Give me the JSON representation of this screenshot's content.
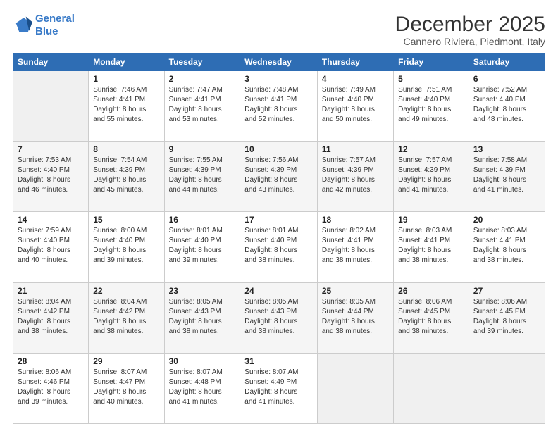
{
  "logo": {
    "line1": "General",
    "line2": "Blue"
  },
  "title": "December 2025",
  "subtitle": "Cannero Riviera, Piedmont, Italy",
  "header_days": [
    "Sunday",
    "Monday",
    "Tuesday",
    "Wednesday",
    "Thursday",
    "Friday",
    "Saturday"
  ],
  "weeks": [
    [
      {
        "day": "",
        "info": ""
      },
      {
        "day": "1",
        "info": "Sunrise: 7:46 AM\nSunset: 4:41 PM\nDaylight: 8 hours\nand 55 minutes."
      },
      {
        "day": "2",
        "info": "Sunrise: 7:47 AM\nSunset: 4:41 PM\nDaylight: 8 hours\nand 53 minutes."
      },
      {
        "day": "3",
        "info": "Sunrise: 7:48 AM\nSunset: 4:41 PM\nDaylight: 8 hours\nand 52 minutes."
      },
      {
        "day": "4",
        "info": "Sunrise: 7:49 AM\nSunset: 4:40 PM\nDaylight: 8 hours\nand 50 minutes."
      },
      {
        "day": "5",
        "info": "Sunrise: 7:51 AM\nSunset: 4:40 PM\nDaylight: 8 hours\nand 49 minutes."
      },
      {
        "day": "6",
        "info": "Sunrise: 7:52 AM\nSunset: 4:40 PM\nDaylight: 8 hours\nand 48 minutes."
      }
    ],
    [
      {
        "day": "7",
        "info": "Sunrise: 7:53 AM\nSunset: 4:40 PM\nDaylight: 8 hours\nand 46 minutes."
      },
      {
        "day": "8",
        "info": "Sunrise: 7:54 AM\nSunset: 4:39 PM\nDaylight: 8 hours\nand 45 minutes."
      },
      {
        "day": "9",
        "info": "Sunrise: 7:55 AM\nSunset: 4:39 PM\nDaylight: 8 hours\nand 44 minutes."
      },
      {
        "day": "10",
        "info": "Sunrise: 7:56 AM\nSunset: 4:39 PM\nDaylight: 8 hours\nand 43 minutes."
      },
      {
        "day": "11",
        "info": "Sunrise: 7:57 AM\nSunset: 4:39 PM\nDaylight: 8 hours\nand 42 minutes."
      },
      {
        "day": "12",
        "info": "Sunrise: 7:57 AM\nSunset: 4:39 PM\nDaylight: 8 hours\nand 41 minutes."
      },
      {
        "day": "13",
        "info": "Sunrise: 7:58 AM\nSunset: 4:39 PM\nDaylight: 8 hours\nand 41 minutes."
      }
    ],
    [
      {
        "day": "14",
        "info": "Sunrise: 7:59 AM\nSunset: 4:40 PM\nDaylight: 8 hours\nand 40 minutes."
      },
      {
        "day": "15",
        "info": "Sunrise: 8:00 AM\nSunset: 4:40 PM\nDaylight: 8 hours\nand 39 minutes."
      },
      {
        "day": "16",
        "info": "Sunrise: 8:01 AM\nSunset: 4:40 PM\nDaylight: 8 hours\nand 39 minutes."
      },
      {
        "day": "17",
        "info": "Sunrise: 8:01 AM\nSunset: 4:40 PM\nDaylight: 8 hours\nand 38 minutes."
      },
      {
        "day": "18",
        "info": "Sunrise: 8:02 AM\nSunset: 4:41 PM\nDaylight: 8 hours\nand 38 minutes."
      },
      {
        "day": "19",
        "info": "Sunrise: 8:03 AM\nSunset: 4:41 PM\nDaylight: 8 hours\nand 38 minutes."
      },
      {
        "day": "20",
        "info": "Sunrise: 8:03 AM\nSunset: 4:41 PM\nDaylight: 8 hours\nand 38 minutes."
      }
    ],
    [
      {
        "day": "21",
        "info": "Sunrise: 8:04 AM\nSunset: 4:42 PM\nDaylight: 8 hours\nand 38 minutes."
      },
      {
        "day": "22",
        "info": "Sunrise: 8:04 AM\nSunset: 4:42 PM\nDaylight: 8 hours\nand 38 minutes."
      },
      {
        "day": "23",
        "info": "Sunrise: 8:05 AM\nSunset: 4:43 PM\nDaylight: 8 hours\nand 38 minutes."
      },
      {
        "day": "24",
        "info": "Sunrise: 8:05 AM\nSunset: 4:43 PM\nDaylight: 8 hours\nand 38 minutes."
      },
      {
        "day": "25",
        "info": "Sunrise: 8:05 AM\nSunset: 4:44 PM\nDaylight: 8 hours\nand 38 minutes."
      },
      {
        "day": "26",
        "info": "Sunrise: 8:06 AM\nSunset: 4:45 PM\nDaylight: 8 hours\nand 38 minutes."
      },
      {
        "day": "27",
        "info": "Sunrise: 8:06 AM\nSunset: 4:45 PM\nDaylight: 8 hours\nand 39 minutes."
      }
    ],
    [
      {
        "day": "28",
        "info": "Sunrise: 8:06 AM\nSunset: 4:46 PM\nDaylight: 8 hours\nand 39 minutes."
      },
      {
        "day": "29",
        "info": "Sunrise: 8:07 AM\nSunset: 4:47 PM\nDaylight: 8 hours\nand 40 minutes."
      },
      {
        "day": "30",
        "info": "Sunrise: 8:07 AM\nSunset: 4:48 PM\nDaylight: 8 hours\nand 41 minutes."
      },
      {
        "day": "31",
        "info": "Sunrise: 8:07 AM\nSunset: 4:49 PM\nDaylight: 8 hours\nand 41 minutes."
      },
      {
        "day": "",
        "info": ""
      },
      {
        "day": "",
        "info": ""
      },
      {
        "day": "",
        "info": ""
      }
    ]
  ]
}
